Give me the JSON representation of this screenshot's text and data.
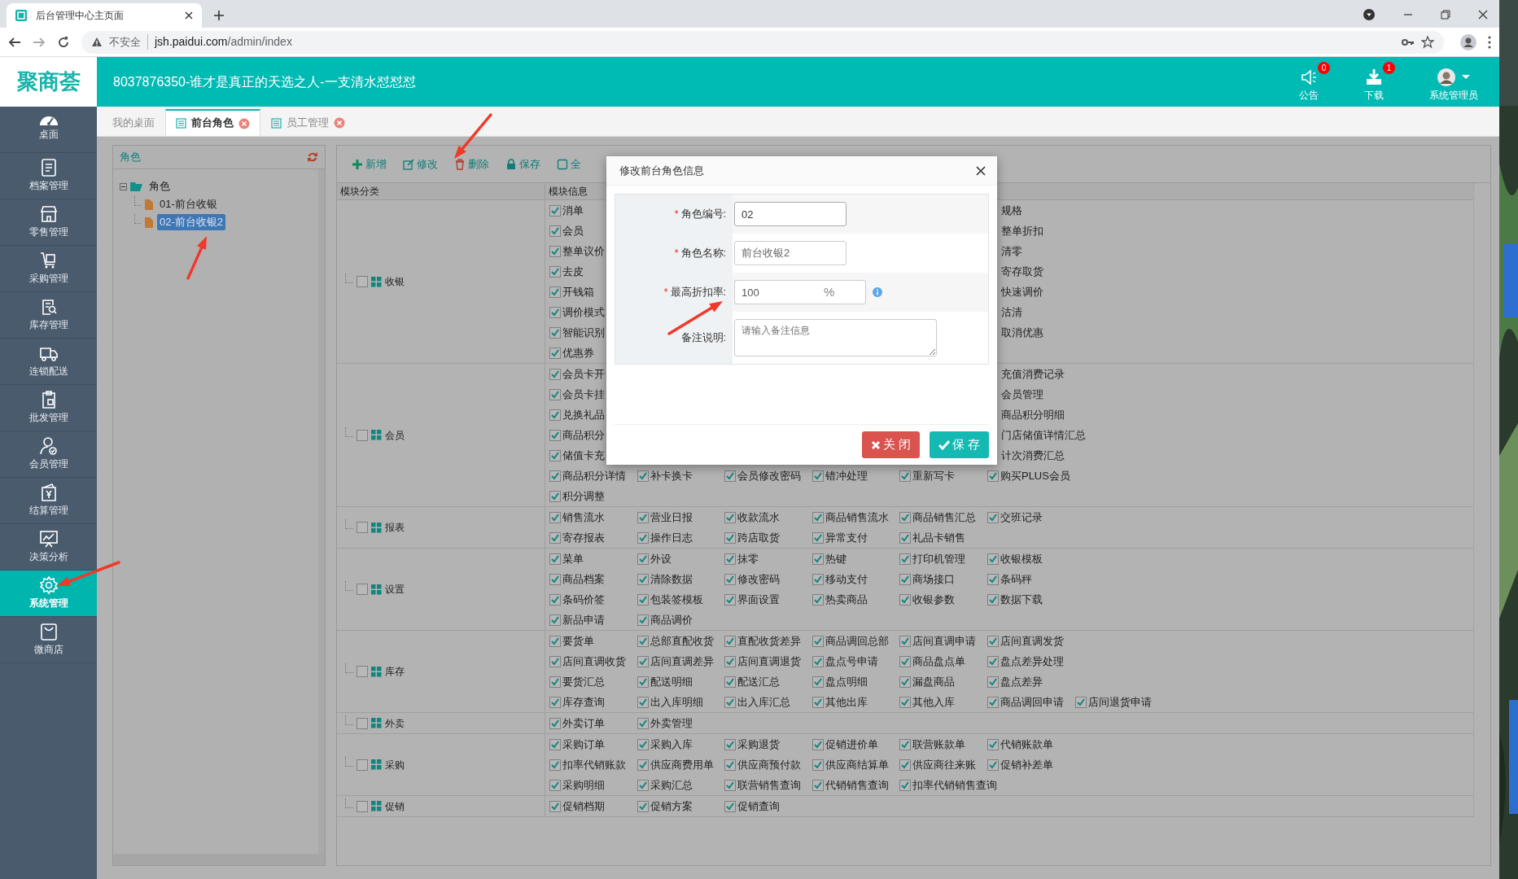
{
  "browser": {
    "tab_title": "后台管理中心主页面",
    "security": "不安全",
    "url_host": "jsh.paidui.com",
    "url_path": "/admin/index"
  },
  "header": {
    "logo": "聚商荟",
    "title": "8037876350-谁才是真正的天选之人-一支清水怼怼怼",
    "actions": [
      {
        "label": "公告",
        "badge": "0"
      },
      {
        "label": "下载",
        "badge": "1"
      }
    ],
    "user": "系统管理员"
  },
  "sidebar": {
    "items": [
      {
        "label": "桌面",
        "selected": false
      },
      {
        "label": "档案管理",
        "selected": false
      },
      {
        "label": "零售管理",
        "selected": false
      },
      {
        "label": "采购管理",
        "selected": false
      },
      {
        "label": "库存管理",
        "selected": false
      },
      {
        "label": "连锁配送",
        "selected": false
      },
      {
        "label": "批发管理",
        "selected": false
      },
      {
        "label": "会员管理",
        "selected": false
      },
      {
        "label": "结算管理",
        "selected": false
      },
      {
        "label": "决策分析",
        "selected": false
      },
      {
        "label": "系统管理",
        "selected": true
      },
      {
        "label": "微商店",
        "selected": false
      }
    ]
  },
  "tabs": [
    {
      "label": "我的桌面",
      "selected": false,
      "closable": false
    },
    {
      "label": "前台角色",
      "selected": true,
      "closable": true
    },
    {
      "label": "员工管理",
      "selected": false,
      "closable": true
    }
  ],
  "role_panel": {
    "title": "角色",
    "tree": [
      {
        "label": "角色",
        "expanded": true,
        "selected": false,
        "children": [
          {
            "label": "01-前台收银",
            "selected": false
          },
          {
            "label": "02-前台收银2",
            "selected": true
          }
        ]
      }
    ]
  },
  "toolbar": [
    {
      "label": "新增"
    },
    {
      "label": "修改"
    },
    {
      "label": "删除"
    },
    {
      "label": "保存"
    },
    {
      "label": "全"
    }
  ],
  "table": {
    "columns": [
      "模块分类",
      "模块信息"
    ],
    "rows": [
      {
        "category": "收银",
        "checked": false,
        "lines": [
          {
            "kind": "split",
            "cells": [
              {
                "kind": "check",
                "label": "消单",
                "checked": true
              },
              {
                "kind": "label",
                "label": "规格"
              }
            ]
          },
          {
            "kind": "split",
            "cells": [
              {
                "kind": "check",
                "label": "会员",
                "checked": true
              },
              {
                "kind": "label",
                "label": "整单折扣"
              }
            ]
          },
          {
            "kind": "split",
            "cells": [
              {
                "kind": "check",
                "label": "整单议价",
                "checked": true
              },
              {
                "kind": "label",
                "label": "清零"
              }
            ]
          },
          {
            "kind": "split",
            "cells": [
              {
                "kind": "check",
                "label": "去皮",
                "checked": true
              },
              {
                "kind": "label",
                "label": "寄存取货"
              }
            ]
          },
          {
            "kind": "split",
            "cells": [
              {
                "kind": "check",
                "label": "开钱箱",
                "checked": true
              },
              {
                "kind": "label",
                "label": "快速调价"
              }
            ]
          },
          {
            "kind": "split",
            "cells": [
              {
                "kind": "check",
                "label": "调价模式",
                "checked": true
              },
              {
                "kind": "label",
                "label": "沽清"
              }
            ]
          },
          {
            "kind": "split",
            "cells": [
              {
                "kind": "check",
                "label": "智能识别",
                "checked": true
              },
              {
                "kind": "label",
                "label": "取消优惠"
              }
            ]
          },
          {
            "kind": "flow",
            "cells": [
              {
                "kind": "check",
                "label": "优惠券",
                "checked": true
              }
            ]
          }
        ]
      },
      {
        "category": "会员",
        "checked": false,
        "lines": [
          {
            "kind": "split",
            "cells": [
              {
                "kind": "check",
                "label": "会员卡开",
                "checked": true
              },
              {
                "kind": "label",
                "label": "充值消费记录"
              }
            ]
          },
          {
            "kind": "split",
            "cells": [
              {
                "kind": "check",
                "label": "会员卡挂",
                "checked": true
              },
              {
                "kind": "label",
                "label": "会员管理"
              }
            ]
          },
          {
            "kind": "split",
            "cells": [
              {
                "kind": "check",
                "label": "兑换礼品",
                "checked": true
              },
              {
                "kind": "label",
                "label": "商品积分明细"
              }
            ]
          },
          {
            "kind": "split",
            "cells": [
              {
                "kind": "check",
                "label": "商品积分",
                "checked": true
              },
              {
                "kind": "label",
                "label": "门店储值详情汇总"
              }
            ]
          },
          {
            "kind": "split",
            "cells": [
              {
                "kind": "check",
                "label": "储值卡充",
                "checked": true
              },
              {
                "kind": "label",
                "label": "计次消费汇总"
              }
            ]
          },
          {
            "kind": "flow",
            "cells": [
              {
                "kind": "check",
                "label": "商品积分详情",
                "checked": true
              },
              {
                "kind": "check",
                "label": "补卡换卡",
                "checked": true
              },
              {
                "kind": "check",
                "label": "会员修改密码",
                "checked": true
              },
              {
                "kind": "check",
                "label": "错冲处理",
                "checked": true
              },
              {
                "kind": "check",
                "label": "重新写卡",
                "checked": true
              },
              {
                "kind": "check",
                "label": "购买PLUS会员",
                "checked": true
              }
            ]
          },
          {
            "kind": "flow",
            "cells": [
              {
                "kind": "check",
                "label": "积分调整",
                "checked": true
              }
            ]
          }
        ]
      },
      {
        "category": "报表",
        "checked": false,
        "lines": [
          {
            "kind": "flow",
            "cells": [
              {
                "kind": "check",
                "label": "销售流水",
                "checked": true
              },
              {
                "kind": "check",
                "label": "营业日报",
                "checked": true
              },
              {
                "kind": "check",
                "label": "收款流水",
                "checked": true
              },
              {
                "kind": "check",
                "label": "商品销售流水",
                "checked": true
              },
              {
                "kind": "check",
                "label": "商品销售汇总",
                "checked": true
              },
              {
                "kind": "check",
                "label": "交班记录",
                "checked": true
              }
            ]
          },
          {
            "kind": "flow",
            "cells": [
              {
                "kind": "check",
                "label": "寄存报表",
                "checked": true
              },
              {
                "kind": "check",
                "label": "操作日志",
                "checked": true
              },
              {
                "kind": "check",
                "label": "跨店取货",
                "checked": true
              },
              {
                "kind": "check",
                "label": "异常支付",
                "checked": true
              },
              {
                "kind": "check",
                "label": "礼品卡销售",
                "checked": true
              }
            ]
          }
        ]
      },
      {
        "category": "设置",
        "checked": false,
        "lines": [
          {
            "kind": "flow",
            "cells": [
              {
                "kind": "check",
                "label": "菜单",
                "checked": true
              },
              {
                "kind": "check",
                "label": "外设",
                "checked": true
              },
              {
                "kind": "check",
                "label": "抹零",
                "checked": true
              },
              {
                "kind": "check",
                "label": "热键",
                "checked": true
              },
              {
                "kind": "check",
                "label": "打印机管理",
                "checked": true
              },
              {
                "kind": "check",
                "label": "收银模板",
                "checked": true
              }
            ]
          },
          {
            "kind": "flow",
            "cells": [
              {
                "kind": "check",
                "label": "商品档案",
                "checked": true
              },
              {
                "kind": "check",
                "label": "清除数据",
                "checked": true
              },
              {
                "kind": "check",
                "label": "修改密码",
                "checked": true
              },
              {
                "kind": "check",
                "label": "移动支付",
                "checked": true
              },
              {
                "kind": "check",
                "label": "商场接口",
                "checked": true
              },
              {
                "kind": "check",
                "label": "条码秤",
                "checked": true
              }
            ]
          },
          {
            "kind": "flow",
            "cells": [
              {
                "kind": "check",
                "label": "条码价签",
                "checked": true
              },
              {
                "kind": "check",
                "label": "包装签模板",
                "checked": true
              },
              {
                "kind": "check",
                "label": "界面设置",
                "checked": true
              },
              {
                "kind": "check",
                "label": "热卖商品",
                "checked": true
              },
              {
                "kind": "check",
                "label": "收银参数",
                "checked": true
              },
              {
                "kind": "check",
                "label": "数据下载",
                "checked": true
              }
            ]
          },
          {
            "kind": "flow",
            "cells": [
              {
                "kind": "check",
                "label": "新品申请",
                "checked": true
              },
              {
                "kind": "check",
                "label": "商品调价",
                "checked": true
              }
            ]
          }
        ]
      },
      {
        "category": "库存",
        "checked": false,
        "lines": [
          {
            "kind": "flow",
            "cells": [
              {
                "kind": "check",
                "label": "要货单",
                "checked": true
              },
              {
                "kind": "check",
                "label": "总部直配收货",
                "checked": true
              },
              {
                "kind": "check",
                "label": "直配收货差异",
                "checked": true
              },
              {
                "kind": "check",
                "label": "商品调回总部",
                "checked": true
              },
              {
                "kind": "check",
                "label": "店间直调申请",
                "checked": true
              },
              {
                "kind": "check",
                "label": "店间直调发货",
                "checked": true
              }
            ]
          },
          {
            "kind": "flow",
            "cells": [
              {
                "kind": "check",
                "label": "店间直调收货",
                "checked": true
              },
              {
                "kind": "check",
                "label": "店间直调差异",
                "checked": true
              },
              {
                "kind": "check",
                "label": "店间直调退货",
                "checked": true
              },
              {
                "kind": "check",
                "label": "盘点号申请",
                "checked": true
              },
              {
                "kind": "check",
                "label": "商品盘点单",
                "checked": true
              },
              {
                "kind": "check",
                "label": "盘点差异处理",
                "checked": true
              }
            ]
          },
          {
            "kind": "flow",
            "cells": [
              {
                "kind": "check",
                "label": "要货汇总",
                "checked": true
              },
              {
                "kind": "check",
                "label": "配送明细",
                "checked": true
              },
              {
                "kind": "check",
                "label": "配送汇总",
                "checked": true
              },
              {
                "kind": "check",
                "label": "盘点明细",
                "checked": true
              },
              {
                "kind": "check",
                "label": "漏盘商品",
                "checked": true
              },
              {
                "kind": "check",
                "label": "盘点差异",
                "checked": true
              }
            ]
          },
          {
            "kind": "flow",
            "cells": [
              {
                "kind": "check",
                "label": "库存查询",
                "checked": true
              },
              {
                "kind": "check",
                "label": "出入库明细",
                "checked": true
              },
              {
                "kind": "check",
                "label": "出入库汇总",
                "checked": true
              },
              {
                "kind": "check",
                "label": "其他出库",
                "checked": true
              },
              {
                "kind": "check",
                "label": "其他入库",
                "checked": true
              },
              {
                "kind": "check",
                "label": "商品调回申请",
                "checked": true
              },
              {
                "kind": "check",
                "label": "店间退货申请",
                "checked": true
              }
            ]
          }
        ]
      },
      {
        "category": "外卖",
        "checked": false,
        "lines": [
          {
            "kind": "flow",
            "cells": [
              {
                "kind": "check",
                "label": "外卖订单",
                "checked": true
              },
              {
                "kind": "check",
                "label": "外卖管理",
                "checked": true
              }
            ]
          }
        ]
      },
      {
        "category": "采购",
        "checked": false,
        "lines": [
          {
            "kind": "flow",
            "cells": [
              {
                "kind": "check",
                "label": "采购订单",
                "checked": true
              },
              {
                "kind": "check",
                "label": "采购入库",
                "checked": true
              },
              {
                "kind": "check",
                "label": "采购退货",
                "checked": true
              },
              {
                "kind": "check",
                "label": "促销进价单",
                "checked": true
              },
              {
                "kind": "check",
                "label": "联营账款单",
                "checked": true
              },
              {
                "kind": "check",
                "label": "代销账款单",
                "checked": true
              }
            ]
          },
          {
            "kind": "flow",
            "cells": [
              {
                "kind": "check",
                "label": "扣率代销账款",
                "checked": true
              },
              {
                "kind": "check",
                "label": "供应商费用单",
                "checked": true
              },
              {
                "kind": "check",
                "label": "供应商预付款",
                "checked": true
              },
              {
                "kind": "check",
                "label": "供应商结算单",
                "checked": true
              },
              {
                "kind": "check",
                "label": "供应商往来账",
                "checked": true
              },
              {
                "kind": "check",
                "label": "促销补差单",
                "checked": true
              }
            ]
          },
          {
            "kind": "flow",
            "cells": [
              {
                "kind": "check",
                "label": "采购明细",
                "checked": true
              },
              {
                "kind": "check",
                "label": "采购汇总",
                "checked": true
              },
              {
                "kind": "check",
                "label": "联营销售查询",
                "checked": true
              },
              {
                "kind": "check",
                "label": "代销销售查询",
                "checked": true
              },
              {
                "kind": "check",
                "label": "扣率代销销售查询",
                "checked": true
              }
            ]
          }
        ]
      },
      {
        "category": "促销",
        "checked": false,
        "lines": [
          {
            "kind": "flow",
            "cells": [
              {
                "kind": "check",
                "label": "促销档期",
                "checked": true
              },
              {
                "kind": "check",
                "label": "促销方案",
                "checked": true
              },
              {
                "kind": "check",
                "label": "促销查询",
                "checked": true
              }
            ]
          }
        ]
      }
    ]
  },
  "dialog": {
    "title": "修改前台角色信息",
    "fields": [
      {
        "mark": "*",
        "label": "角色编号:",
        "kind": "text",
        "value": "02",
        "disabled": false
      },
      {
        "mark": "*",
        "label": "角色名称:",
        "kind": "text",
        "value": "前台收银2",
        "disabled": true
      },
      {
        "mark": "*",
        "label": "最高折扣率:",
        "kind": "percent",
        "value": "100",
        "suffix": "%"
      },
      {
        "label": "备注说明:",
        "kind": "textarea",
        "placeholder": "请输入备注信息"
      }
    ],
    "buttons": [
      {
        "label": "关 闭",
        "kind": "close"
      },
      {
        "label": "保 存",
        "kind": "save"
      }
    ]
  }
}
